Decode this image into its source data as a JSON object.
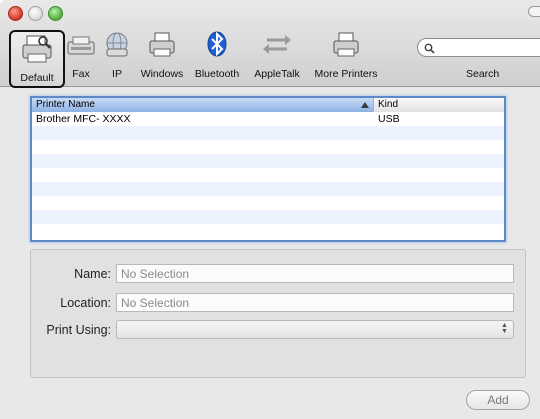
{
  "toolbar": {
    "items": [
      {
        "label": "Default",
        "icon": "default-printer-icon",
        "selected": true
      },
      {
        "label": "Fax",
        "icon": "fax-icon"
      },
      {
        "label": "IP",
        "icon": "globe-icon"
      },
      {
        "label": "Windows",
        "icon": "windows-printer-icon"
      },
      {
        "label": "Bluetooth",
        "icon": "bluetooth-icon"
      },
      {
        "label": "AppleTalk",
        "icon": "appletalk-icon"
      },
      {
        "label": "More Printers",
        "icon": "more-printers-icon"
      }
    ],
    "search": {
      "label": "Search",
      "value": ""
    }
  },
  "printer_list": {
    "columns": {
      "name": "Printer Name",
      "kind": "Kind"
    },
    "rows": [
      {
        "name": "Brother MFC- XXXX",
        "kind": "USB"
      }
    ]
  },
  "info": {
    "name_label": "Name:",
    "name_value": "No Selection",
    "location_label": "Location:",
    "location_value": "No Selection",
    "print_using_label": "Print Using:",
    "print_using_value": ""
  },
  "add_button": "Add",
  "colors": {
    "accent": "#5d89c8",
    "header_selected": "#8db2e4",
    "bluetooth": "#1f5fd6"
  }
}
